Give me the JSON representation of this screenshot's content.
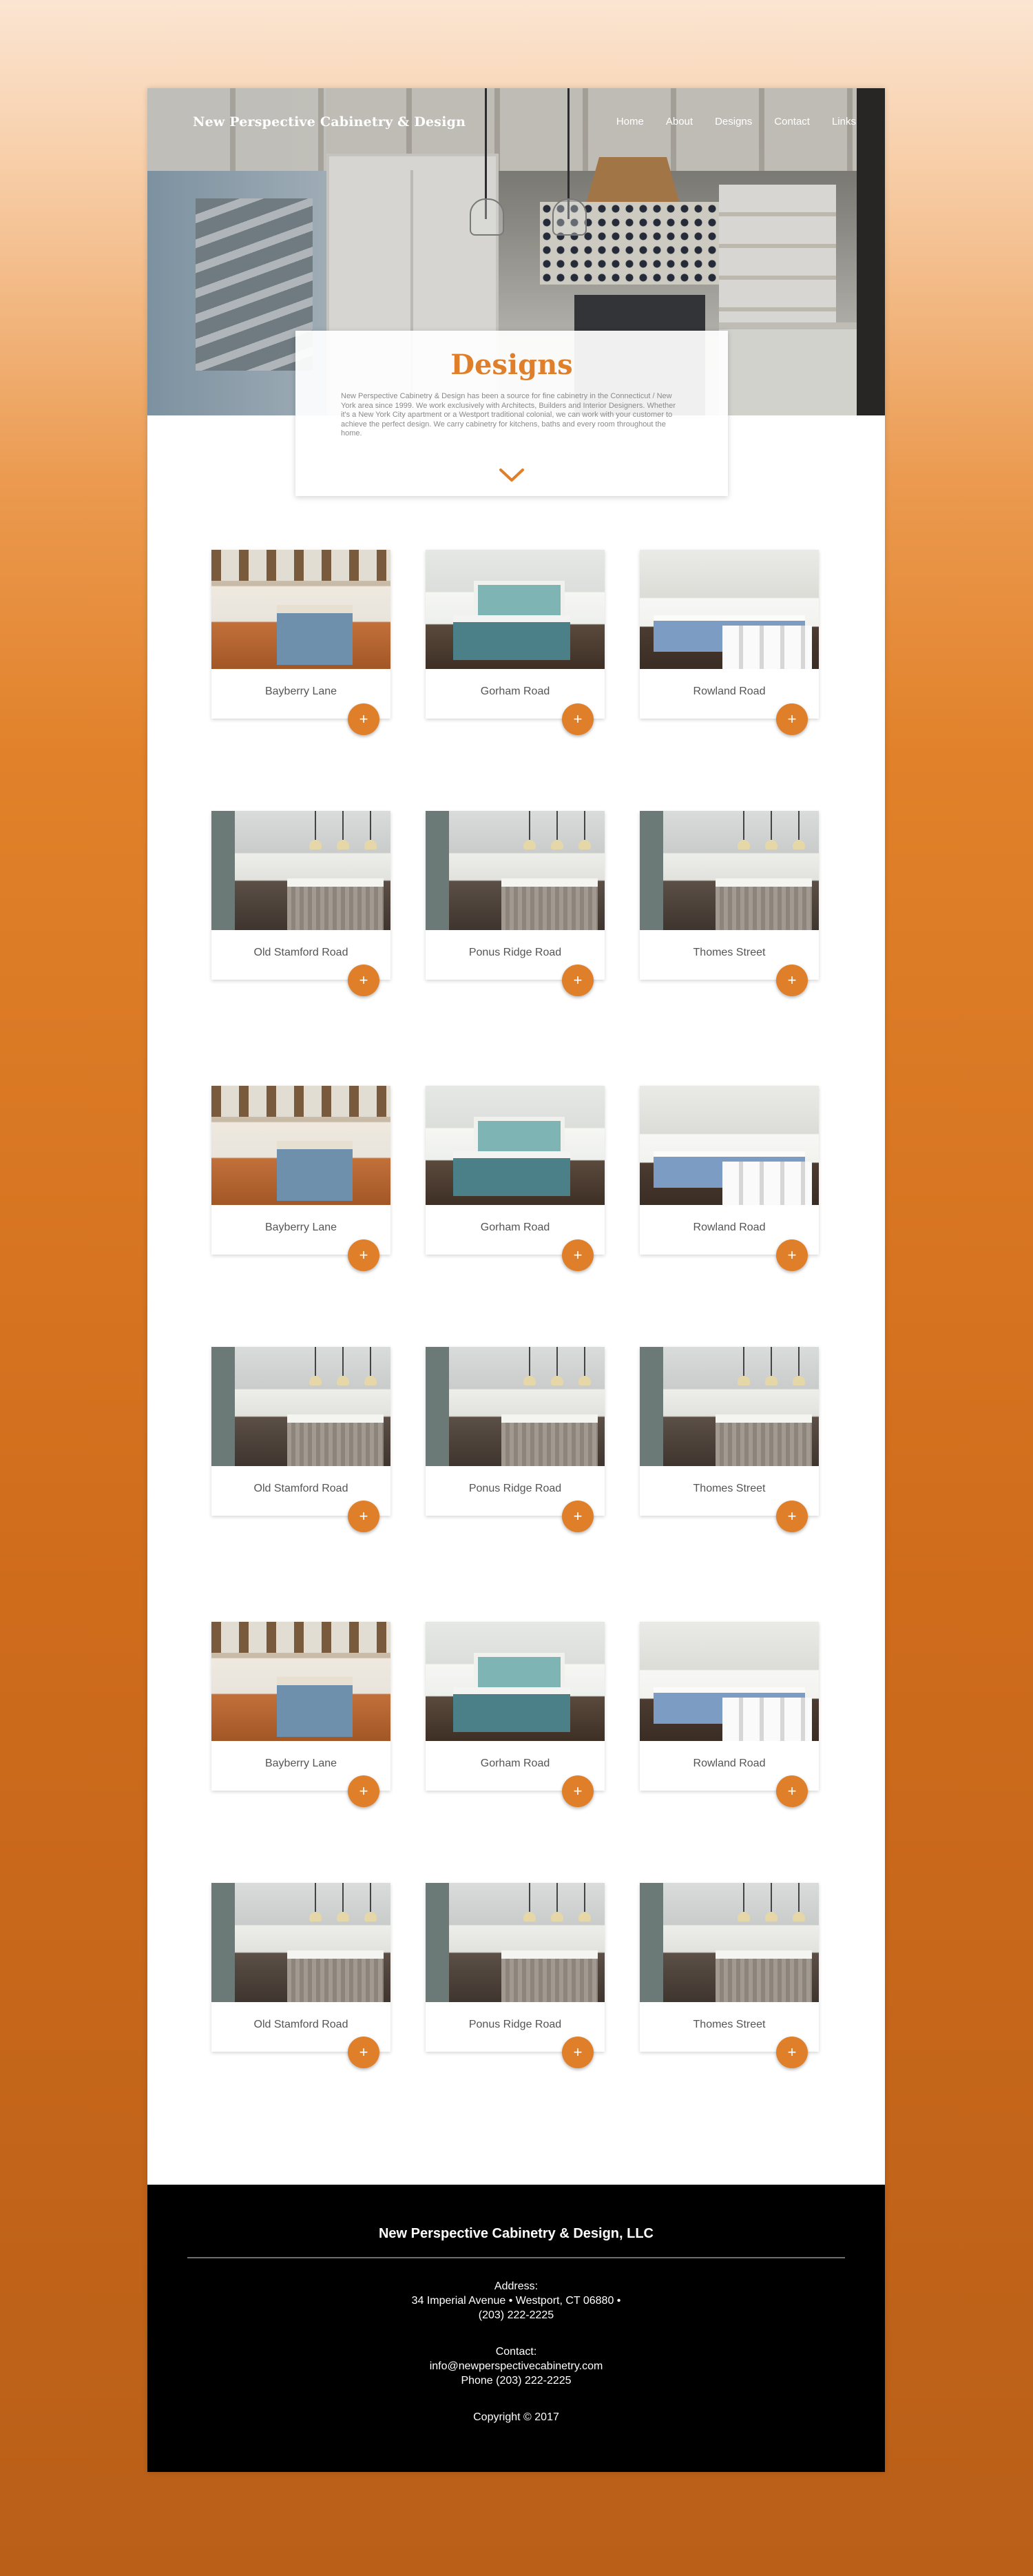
{
  "header": {
    "brand": "New Perspective Cabinetry & Design",
    "nav": [
      "Home",
      "About",
      "Designs",
      "Contact",
      "Links"
    ]
  },
  "intro": {
    "title": "Designs",
    "text": "New Perspective Cabinetry & Design has been a source for fine cabinetry in the Connecticut / New York area since 1999. We work exclusively with Architects, Builders and Interior Designers. Whether it's a New York City apartment or a Westport traditional colonial, we can work with your customer to achieve the perfect design. We carry cabinetry for kitchens, baths and every room throughout the home.",
    "more_icon": "chevron-down-icon"
  },
  "gallery": {
    "rows": [
      [
        "Bayberry Lane",
        "Gorham Road",
        "Rowland Road"
      ],
      [
        "Old Stamford Road",
        "Ponus Ridge Road",
        "Thomes Street"
      ],
      [
        "Bayberry Lane",
        "Gorham Road",
        "Rowland Road"
      ],
      [
        "Old Stamford Road",
        "Ponus Ridge Road",
        "Thomes Street"
      ],
      [
        "Bayberry Lane",
        "Gorham Road",
        "Rowland Road"
      ],
      [
        "Old Stamford Road",
        "Ponus Ridge Road",
        "Thomes Street"
      ]
    ],
    "expand_symbol": "+"
  },
  "footer": {
    "company": "New Perspective Cabinetry & Design, LLC",
    "address_label": "Address:",
    "address_line": "34 Imperial Avenue • Westport, CT 06880 •",
    "address_phone": "(203) 222-2225",
    "contact_label": "Contact:",
    "email": "info@newperspectivecabinetry.com",
    "phone": "Phone (203) 222-2225",
    "copyright": "Copyright © 2017"
  },
  "colors": {
    "accent": "#e07f2a",
    "footer_bg": "#000000"
  }
}
